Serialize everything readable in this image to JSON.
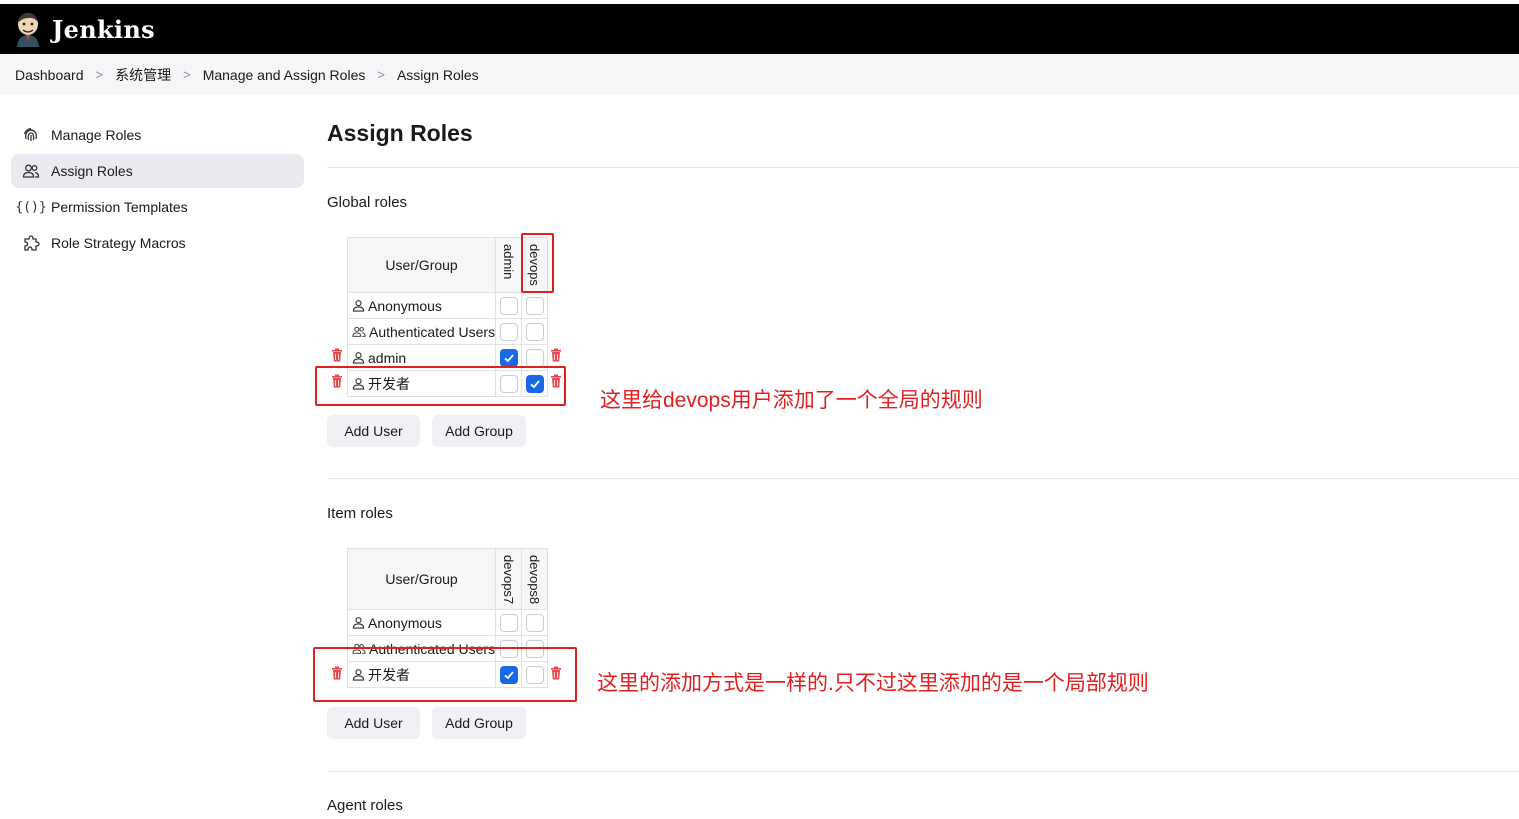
{
  "app": {
    "title": "Jenkins"
  },
  "breadcrumb": [
    "Dashboard",
    "系统管理",
    "Manage and Assign Roles",
    "Assign Roles"
  ],
  "sidebar": {
    "items": [
      {
        "label": "Manage Roles",
        "icon": "fingerprint-icon"
      },
      {
        "label": "Assign Roles",
        "icon": "users-icon",
        "active": true
      },
      {
        "label": "Permission Templates",
        "icon": "braces-icon"
      },
      {
        "label": "Role Strategy Macros",
        "icon": "puzzle-icon"
      }
    ]
  },
  "page": {
    "title": "Assign Roles"
  },
  "global_roles": {
    "title": "Global roles",
    "header": "User/Group",
    "roles": [
      "admin",
      "devops"
    ],
    "rows": [
      {
        "name": "Anonymous",
        "icon": "user-icon",
        "checks": [
          false,
          false
        ],
        "deletable": false
      },
      {
        "name": "Authenticated Users",
        "icon": "group-icon",
        "checks": [
          false,
          false
        ],
        "deletable": false
      },
      {
        "name": "admin",
        "icon": "user-icon",
        "checks": [
          true,
          false
        ],
        "deletable": true
      },
      {
        "name": "开发者",
        "icon": "user-icon",
        "checks": [
          false,
          true
        ],
        "deletable": true
      }
    ],
    "add_user": "Add User",
    "add_group": "Add Group"
  },
  "item_roles": {
    "title": "Item roles",
    "header": "User/Group",
    "roles": [
      "devops7",
      "devops8"
    ],
    "rows": [
      {
        "name": "Anonymous",
        "icon": "user-icon",
        "checks": [
          false,
          false
        ],
        "deletable": false
      },
      {
        "name": "Authenticated Users",
        "icon": "group-icon",
        "checks": [
          false,
          false
        ],
        "deletable": false
      },
      {
        "name": "开发者",
        "icon": "user-icon",
        "checks": [
          true,
          false
        ],
        "deletable": true
      }
    ],
    "add_user": "Add User",
    "add_group": "Add Group"
  },
  "agent_roles": {
    "title": "Agent roles"
  },
  "annotations": {
    "global": "这里给devops用户添加了一个全局的规则",
    "item": "这里的添加方式是一样的.只不过这里添加的是一个局部规则"
  },
  "colors": {
    "accent": "#1969e6",
    "annotation": "#e02020",
    "delete": "#e5484d"
  }
}
